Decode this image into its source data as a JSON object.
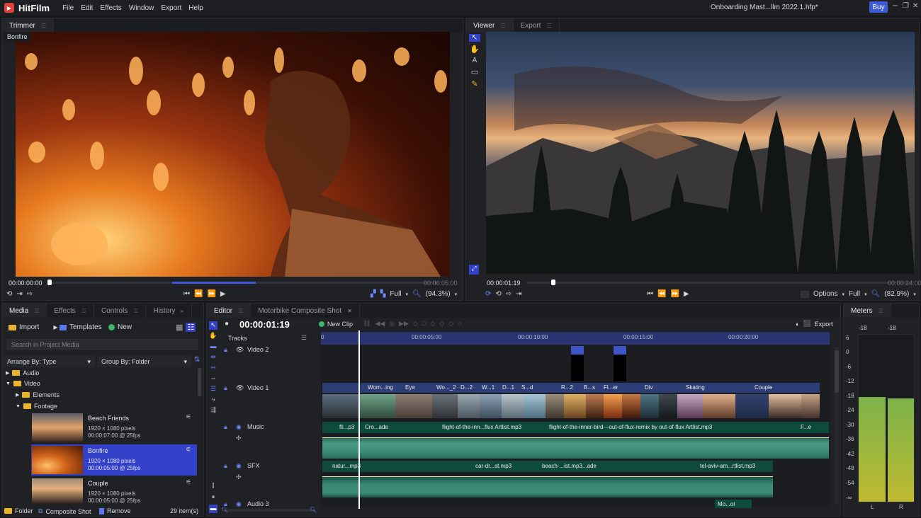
{
  "app": {
    "name": "HitFilm",
    "menu": [
      "File",
      "Edit",
      "Effects",
      "Window",
      "Export",
      "Help"
    ],
    "project_name": "Onboarding Mast...llm 2022.1.hfp*",
    "buy_label": "Buy",
    "accent": "#3d5bd9"
  },
  "trimmer": {
    "tab": "Trimmer",
    "clip_label": "Bonfire",
    "time_start": "00:00:00:00",
    "time_end": "00:00:05:00",
    "zoom_mode": "Full",
    "zoom_pct": "(94.3%)"
  },
  "viewer": {
    "tabs": [
      "Viewer",
      "Export"
    ],
    "time_current": "00:00:01:19",
    "time_end": "00:00:24:00",
    "options_label": "Options",
    "zoom_mode": "Full",
    "zoom_pct": "(82.9%)"
  },
  "media": {
    "tabs": [
      "Media",
      "Effects",
      "Controls",
      "History"
    ],
    "import_label": "Import",
    "templates_label": "Templates",
    "new_label": "New",
    "search_placeholder": "Search in Project Media",
    "arrange_label": "Arrange By: Type",
    "group_label": "Group By: Folder",
    "tree": [
      "Audio",
      "Video",
      "Elements",
      "Footage"
    ],
    "items": [
      {
        "name": "Beach Friends",
        "res": "1920 × 1080 pixels",
        "dur": "00:00:07:00 @ 25fps"
      },
      {
        "name": "Bonfire",
        "res": "1920 × 1080 pixels",
        "dur": "00:00:05:00 @ 25fps"
      },
      {
        "name": "Couple",
        "res": "1920 × 1080 pixels",
        "dur": "00:00:05:00 @ 25fps"
      }
    ],
    "bottom": {
      "folder": "Folder",
      "composite": "Composite Shot",
      "remove": "Remove",
      "count": "29 item(s)"
    }
  },
  "editor": {
    "tabs": [
      "Editor",
      "Motorbike Composite Shot"
    ],
    "timecode": "00:00:01:19",
    "new_clip_label": "New Clip",
    "export_label": "Export",
    "tracks_label": "Tracks",
    "ruler": [
      "0",
      "00:00:05:00",
      "00:00:10:00",
      "00:00:15:00",
      "00:00:20:00"
    ],
    "tracks": [
      "Video 2",
      "Video 1",
      "Music",
      "SFX",
      "Audio 3"
    ],
    "video1_clips": [
      "Wom...ing",
      "Eye",
      "Wo..._2",
      "D...2",
      "W...1",
      "D...1",
      "S...d",
      "R...2",
      "B...s",
      "Fl...er",
      "Div",
      "Skating",
      "Couple"
    ],
    "music_clips": [
      "fli...p3",
      "Cro...ade",
      "flight-of-the-inn...flux Artlist.mp3",
      "flight-of-the-inner-bird---out-of-flux-remix by out-of-flux Artlist.mp3",
      "F...e"
    ],
    "sfx_clips": [
      "natur...mp3",
      "car-dr...st.mp3",
      "beach-...ist.mp3...ade",
      "tel-aviv-am...rtlist.mp3"
    ],
    "audio3_clip": "Mo...ot"
  },
  "meters": {
    "tab": "Meters",
    "peak_l": "-18",
    "peak_r": "-18",
    "scale": [
      "6",
      "0",
      "-6",
      "-12",
      "-18",
      "-24",
      "-30",
      "-36",
      "-42",
      "-48",
      "-54",
      "-∞"
    ],
    "channels": [
      "L",
      "R"
    ]
  }
}
